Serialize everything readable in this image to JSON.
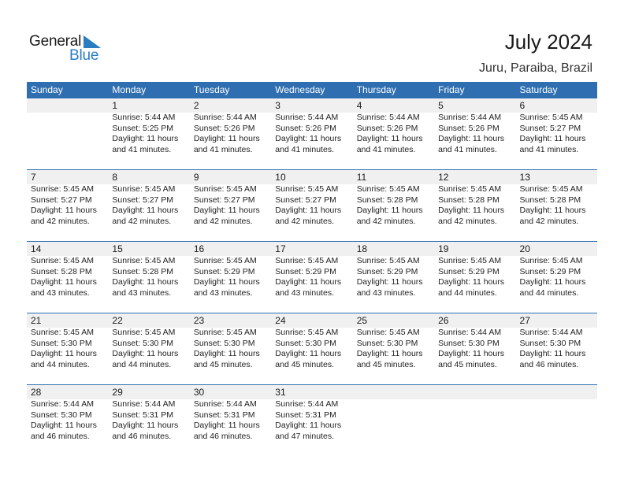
{
  "logo": {
    "text_primary": "General",
    "text_secondary": "Blue",
    "accent_color": "#2a7dc1"
  },
  "header": {
    "title": "July 2024",
    "location": "Juru, Paraiba, Brazil"
  },
  "colors": {
    "header_bg": "#2f6fb1",
    "strip_bg": "#f0f0f0",
    "rule": "#2f6fb1"
  },
  "weekdays": [
    "Sunday",
    "Monday",
    "Tuesday",
    "Wednesday",
    "Thursday",
    "Friday",
    "Saturday"
  ],
  "labels": {
    "sunrise": "Sunrise:",
    "sunset": "Sunset:",
    "daylight": "Daylight:"
  },
  "weeks": [
    [
      null,
      {
        "day": "1",
        "sunrise": "Sunrise: 5:44 AM",
        "sunset": "Sunset: 5:25 PM",
        "daylight": "Daylight: 11 hours",
        "minutes": "and 41 minutes."
      },
      {
        "day": "2",
        "sunrise": "Sunrise: 5:44 AM",
        "sunset": "Sunset: 5:26 PM",
        "daylight": "Daylight: 11 hours",
        "minutes": "and 41 minutes."
      },
      {
        "day": "3",
        "sunrise": "Sunrise: 5:44 AM",
        "sunset": "Sunset: 5:26 PM",
        "daylight": "Daylight: 11 hours",
        "minutes": "and 41 minutes."
      },
      {
        "day": "4",
        "sunrise": "Sunrise: 5:44 AM",
        "sunset": "Sunset: 5:26 PM",
        "daylight": "Daylight: 11 hours",
        "minutes": "and 41 minutes."
      },
      {
        "day": "5",
        "sunrise": "Sunrise: 5:44 AM",
        "sunset": "Sunset: 5:26 PM",
        "daylight": "Daylight: 11 hours",
        "minutes": "and 41 minutes."
      },
      {
        "day": "6",
        "sunrise": "Sunrise: 5:45 AM",
        "sunset": "Sunset: 5:27 PM",
        "daylight": "Daylight: 11 hours",
        "minutes": "and 41 minutes."
      }
    ],
    [
      {
        "day": "7",
        "sunrise": "Sunrise: 5:45 AM",
        "sunset": "Sunset: 5:27 PM",
        "daylight": "Daylight: 11 hours",
        "minutes": "and 42 minutes."
      },
      {
        "day": "8",
        "sunrise": "Sunrise: 5:45 AM",
        "sunset": "Sunset: 5:27 PM",
        "daylight": "Daylight: 11 hours",
        "minutes": "and 42 minutes."
      },
      {
        "day": "9",
        "sunrise": "Sunrise: 5:45 AM",
        "sunset": "Sunset: 5:27 PM",
        "daylight": "Daylight: 11 hours",
        "minutes": "and 42 minutes."
      },
      {
        "day": "10",
        "sunrise": "Sunrise: 5:45 AM",
        "sunset": "Sunset: 5:27 PM",
        "daylight": "Daylight: 11 hours",
        "minutes": "and 42 minutes."
      },
      {
        "day": "11",
        "sunrise": "Sunrise: 5:45 AM",
        "sunset": "Sunset: 5:28 PM",
        "daylight": "Daylight: 11 hours",
        "minutes": "and 42 minutes."
      },
      {
        "day": "12",
        "sunrise": "Sunrise: 5:45 AM",
        "sunset": "Sunset: 5:28 PM",
        "daylight": "Daylight: 11 hours",
        "minutes": "and 42 minutes."
      },
      {
        "day": "13",
        "sunrise": "Sunrise: 5:45 AM",
        "sunset": "Sunset: 5:28 PM",
        "daylight": "Daylight: 11 hours",
        "minutes": "and 42 minutes."
      }
    ],
    [
      {
        "day": "14",
        "sunrise": "Sunrise: 5:45 AM",
        "sunset": "Sunset: 5:28 PM",
        "daylight": "Daylight: 11 hours",
        "minutes": "and 43 minutes."
      },
      {
        "day": "15",
        "sunrise": "Sunrise: 5:45 AM",
        "sunset": "Sunset: 5:28 PM",
        "daylight": "Daylight: 11 hours",
        "minutes": "and 43 minutes."
      },
      {
        "day": "16",
        "sunrise": "Sunrise: 5:45 AM",
        "sunset": "Sunset: 5:29 PM",
        "daylight": "Daylight: 11 hours",
        "minutes": "and 43 minutes."
      },
      {
        "day": "17",
        "sunrise": "Sunrise: 5:45 AM",
        "sunset": "Sunset: 5:29 PM",
        "daylight": "Daylight: 11 hours",
        "minutes": "and 43 minutes."
      },
      {
        "day": "18",
        "sunrise": "Sunrise: 5:45 AM",
        "sunset": "Sunset: 5:29 PM",
        "daylight": "Daylight: 11 hours",
        "minutes": "and 43 minutes."
      },
      {
        "day": "19",
        "sunrise": "Sunrise: 5:45 AM",
        "sunset": "Sunset: 5:29 PM",
        "daylight": "Daylight: 11 hours",
        "minutes": "and 44 minutes."
      },
      {
        "day": "20",
        "sunrise": "Sunrise: 5:45 AM",
        "sunset": "Sunset: 5:29 PM",
        "daylight": "Daylight: 11 hours",
        "minutes": "and 44 minutes."
      }
    ],
    [
      {
        "day": "21",
        "sunrise": "Sunrise: 5:45 AM",
        "sunset": "Sunset: 5:30 PM",
        "daylight": "Daylight: 11 hours",
        "minutes": "and 44 minutes."
      },
      {
        "day": "22",
        "sunrise": "Sunrise: 5:45 AM",
        "sunset": "Sunset: 5:30 PM",
        "daylight": "Daylight: 11 hours",
        "minutes": "and 44 minutes."
      },
      {
        "day": "23",
        "sunrise": "Sunrise: 5:45 AM",
        "sunset": "Sunset: 5:30 PM",
        "daylight": "Daylight: 11 hours",
        "minutes": "and 45 minutes."
      },
      {
        "day": "24",
        "sunrise": "Sunrise: 5:45 AM",
        "sunset": "Sunset: 5:30 PM",
        "daylight": "Daylight: 11 hours",
        "minutes": "and 45 minutes."
      },
      {
        "day": "25",
        "sunrise": "Sunrise: 5:45 AM",
        "sunset": "Sunset: 5:30 PM",
        "daylight": "Daylight: 11 hours",
        "minutes": "and 45 minutes."
      },
      {
        "day": "26",
        "sunrise": "Sunrise: 5:44 AM",
        "sunset": "Sunset: 5:30 PM",
        "daylight": "Daylight: 11 hours",
        "minutes": "and 45 minutes."
      },
      {
        "day": "27",
        "sunrise": "Sunrise: 5:44 AM",
        "sunset": "Sunset: 5:30 PM",
        "daylight": "Daylight: 11 hours",
        "minutes": "and 46 minutes."
      }
    ],
    [
      {
        "day": "28",
        "sunrise": "Sunrise: 5:44 AM",
        "sunset": "Sunset: 5:30 PM",
        "daylight": "Daylight: 11 hours",
        "minutes": "and 46 minutes."
      },
      {
        "day": "29",
        "sunrise": "Sunrise: 5:44 AM",
        "sunset": "Sunset: 5:31 PM",
        "daylight": "Daylight: 11 hours",
        "minutes": "and 46 minutes."
      },
      {
        "day": "30",
        "sunrise": "Sunrise: 5:44 AM",
        "sunset": "Sunset: 5:31 PM",
        "daylight": "Daylight: 11 hours",
        "minutes": "and 46 minutes."
      },
      {
        "day": "31",
        "sunrise": "Sunrise: 5:44 AM",
        "sunset": "Sunset: 5:31 PM",
        "daylight": "Daylight: 11 hours",
        "minutes": "and 47 minutes."
      },
      null,
      null,
      null
    ]
  ]
}
